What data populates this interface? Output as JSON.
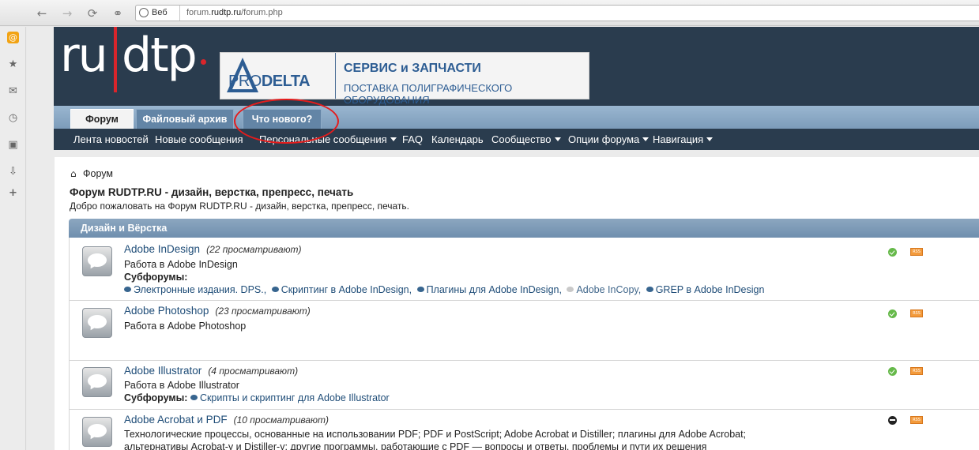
{
  "browser": {
    "web_label": "Веб",
    "url_prefix": "forum.",
    "url_host": "rudtp.ru",
    "url_path": "/forum.php"
  },
  "site": {
    "logo_left": "ru",
    "logo_right": "dtp",
    "banner": {
      "brand_pro": "PRO",
      "brand_delta": "DELTA",
      "title": "СЕРВИС и ЗАПЧАСТИ",
      "subtitle": "ПОСТАВКА ПОЛИГРАФИЧЕСКОГО ОБОРУДОВАНИЯ"
    },
    "tabs": [
      {
        "label": "Форум"
      },
      {
        "label": "Файловый архив"
      },
      {
        "label": "Что нового?"
      }
    ],
    "subnav": [
      {
        "label": "Лента новостей"
      },
      {
        "label": "Новые сообщения"
      },
      {
        "label": "Персональные сообщения"
      },
      {
        "label": "FAQ"
      },
      {
        "label": "Календарь"
      },
      {
        "label": "Сообщество"
      },
      {
        "label": "Опции форума"
      },
      {
        "label": "Навигация"
      }
    ]
  },
  "content": {
    "breadcrumb": "Форум",
    "title": "Форум RUDTP.RU - дизайн, верстка, препресс, печать",
    "description": "Добро пожаловать на Форум RUDTP.RU - дизайн, верстка, препресс, печать.",
    "category": "Дизайн и Вёрстка",
    "subforums_label": "Субфорумы:",
    "forums": [
      {
        "name": "Adobe InDesign",
        "views": "(22 просматривают)",
        "desc": "Работа в Adobe InDesign",
        "subforums": [
          "Электронные издания. DPS.,",
          "Скриптинг в Adobe InDesign,",
          "Плагины для Adobe InDesign,",
          "Adobe InCopy,",
          "GREP в Adobe InDesign"
        ]
      },
      {
        "name": "Adobe Photoshop",
        "views": "(23 просматривают)",
        "desc": "Работа в Adobe Photoshop"
      },
      {
        "name": "Adobe Illustrator",
        "views": "(4 просматривают)",
        "desc": "Работа в Adobe Illustrator",
        "subforums": [
          "Скрипты и скриптинг для Adobe Illustrator"
        ]
      },
      {
        "name": "Adobe Acrobat и PDF",
        "views": "(10 просматривают)",
        "desc": "Технологические процессы, основанные на использовании PDF; PDF и PostScript; Adobe Acrobat и Distiller; плагины для Adobe Acrobat;",
        "desc2": "альтернативы Acrobat-у и Distiller-у; другие программы, работающие с PDF — вопросы и ответы, проблемы и пути их решения"
      }
    ],
    "rss_label": "RSS"
  },
  "icons": [
    "back-icon",
    "forward-icon",
    "reload-icon",
    "key-icon",
    "globe-icon",
    "mail-at-icon",
    "star-icon",
    "envelope-icon",
    "clock-icon",
    "note-icon",
    "download-icon",
    "plus-icon",
    "home-icon",
    "forum-bubble-icon",
    "status-ok-icon",
    "status-closed-icon",
    "rss-icon"
  ]
}
